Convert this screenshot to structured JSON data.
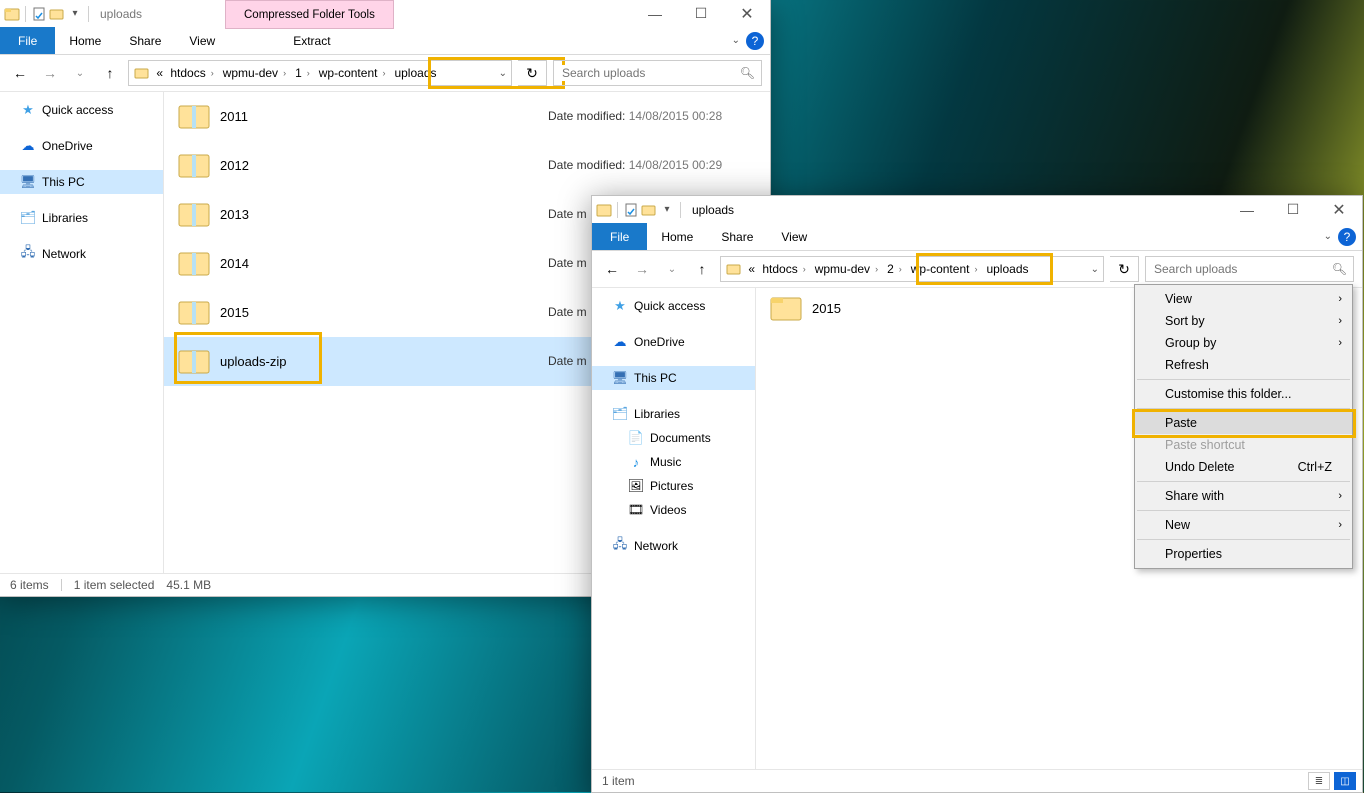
{
  "w1": {
    "title_folder": "uploads",
    "tool_tab": "Compressed Folder Tools",
    "ribbon": {
      "file": "File",
      "home": "Home",
      "share": "Share",
      "view": "View",
      "extract": "Extract"
    },
    "crumbs": [
      "htdocs",
      "wpmu-dev",
      "1",
      "wp-content",
      "uploads"
    ],
    "search_placeholder": "Search uploads",
    "nav": {
      "quick": "Quick access",
      "onedrive": "OneDrive",
      "thispc": "This PC",
      "libraries": "Libraries",
      "network": "Network"
    },
    "files": [
      {
        "name": "2011",
        "meta_label": "Date modified:",
        "meta_value": "14/08/2015 00:28"
      },
      {
        "name": "2012",
        "meta_label": "Date modified:",
        "meta_value": "14/08/2015 00:29"
      },
      {
        "name": "2013",
        "meta_label": "Date m"
      },
      {
        "name": "2014",
        "meta_label": "Date m"
      },
      {
        "name": "2015",
        "meta_label": "Date m"
      },
      {
        "name": "uploads-zip",
        "meta_label": "Date m",
        "selected": true
      }
    ],
    "status": {
      "count": "6 items",
      "sel": "1 item selected",
      "size": "45.1 MB"
    }
  },
  "w2": {
    "title_folder": "uploads",
    "ribbon": {
      "file": "File",
      "home": "Home",
      "share": "Share",
      "view": "View"
    },
    "crumbs": [
      "htdocs",
      "wpmu-dev",
      "2",
      "wp-content",
      "uploads"
    ],
    "search_placeholder": "Search uploads",
    "nav": {
      "quick": "Quick access",
      "onedrive": "OneDrive",
      "thispc": "This PC",
      "libraries": "Libraries",
      "docs": "Documents",
      "music": "Music",
      "pics": "Pictures",
      "videos": "Videos",
      "network": "Network"
    },
    "files": [
      {
        "name": "2015"
      }
    ],
    "status": {
      "count": "1 item"
    },
    "ctx": {
      "view": "View",
      "sort": "Sort by",
      "group": "Group by",
      "refresh": "Refresh",
      "customise": "Customise this folder...",
      "paste": "Paste",
      "paste_shortcut": "Paste shortcut",
      "undo": "Undo Delete",
      "undo_sc": "Ctrl+Z",
      "share_with": "Share with",
      "new": "New",
      "properties": "Properties"
    }
  }
}
